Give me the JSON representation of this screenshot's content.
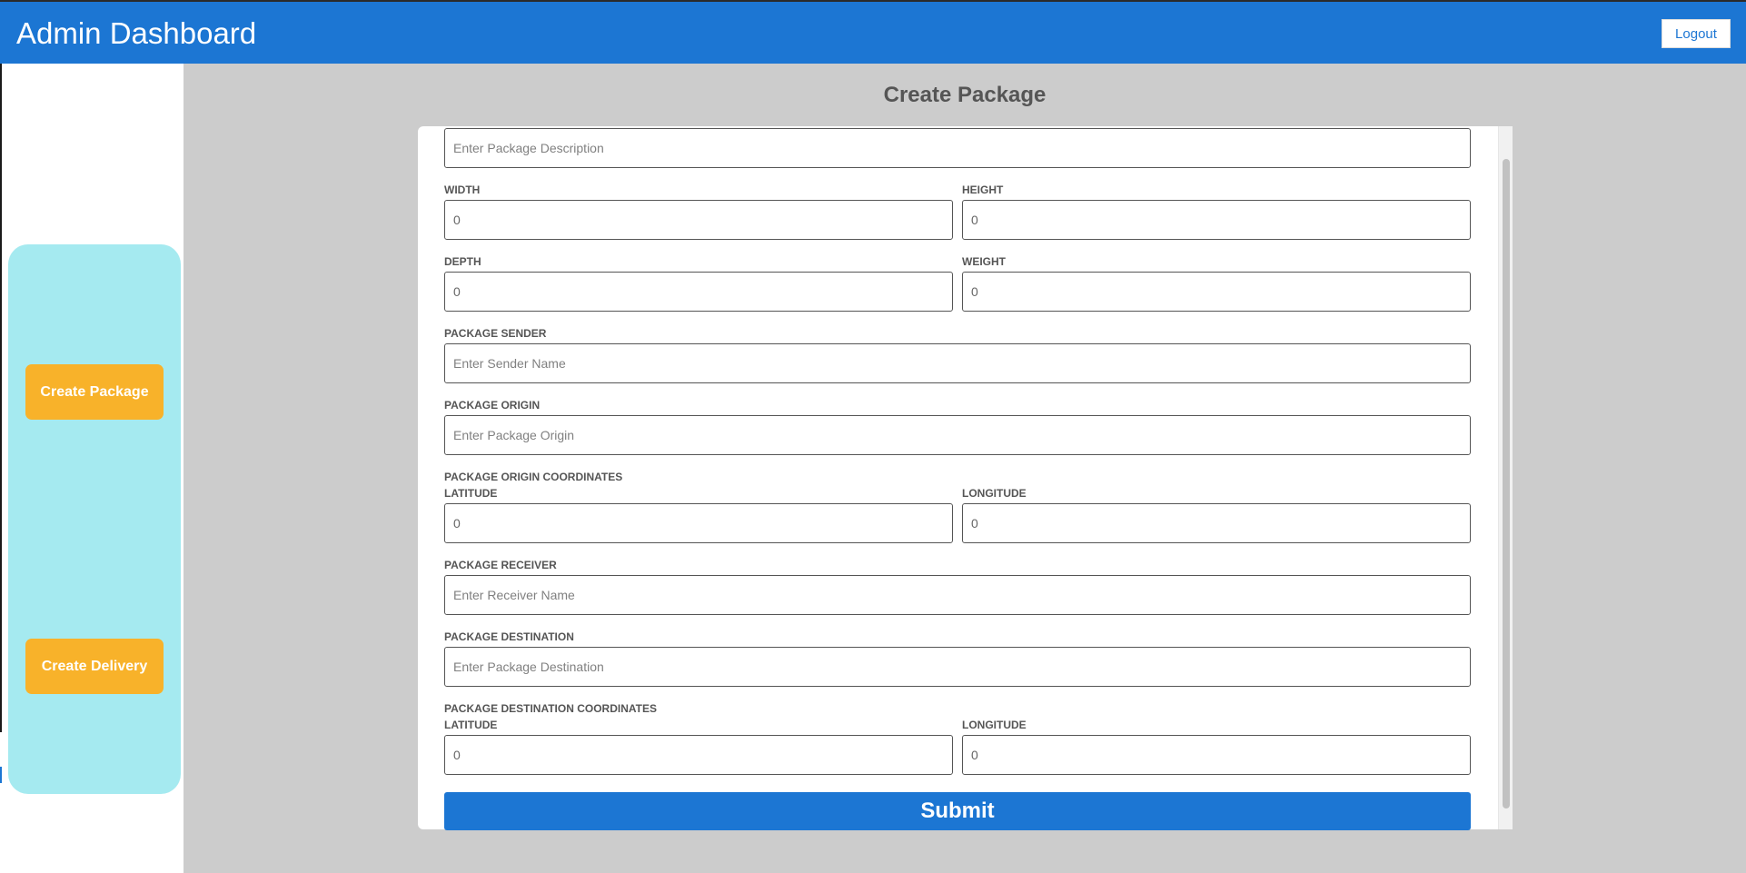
{
  "header": {
    "title": "Admin Dashboard",
    "logout_label": "Logout"
  },
  "sidebar": {
    "create_package_label": "Create Package",
    "create_delivery_label": "Create Delivery"
  },
  "main": {
    "title": "Create Package"
  },
  "form": {
    "description": {
      "placeholder": "Enter Package Description"
    },
    "width": {
      "label": "Width",
      "value": "0"
    },
    "height": {
      "label": "Height",
      "value": "0"
    },
    "depth": {
      "label": "Depth",
      "value": "0"
    },
    "weight": {
      "label": "Weight",
      "value": "0"
    },
    "sender": {
      "label": "Package Sender",
      "placeholder": "Enter Sender Name"
    },
    "origin": {
      "label": "Package Origin",
      "placeholder": "Enter Package Origin"
    },
    "origin_coords": {
      "label": "Package Origin Coordinates",
      "latitude_label": "Latitude",
      "latitude_value": "0",
      "longitude_label": "Longitude",
      "longitude_value": "0"
    },
    "receiver": {
      "label": "Package Receiver",
      "placeholder": "Enter Receiver Name"
    },
    "destination": {
      "label": "Package Destination",
      "placeholder": "Enter Package Destination"
    },
    "destination_coords": {
      "label": "Package Destination Coordinates",
      "latitude_label": "Latitude",
      "latitude_value": "0",
      "longitude_label": "Longitude",
      "longitude_value": "0"
    },
    "submit_label": "Submit"
  },
  "colors": {
    "header_bg": "#1c76d3",
    "sidebar_panel": "#a5eaf0",
    "sidebar_button": "#f8b22a",
    "main_bg": "#cccccc",
    "submit_bg": "#1c76d3"
  }
}
